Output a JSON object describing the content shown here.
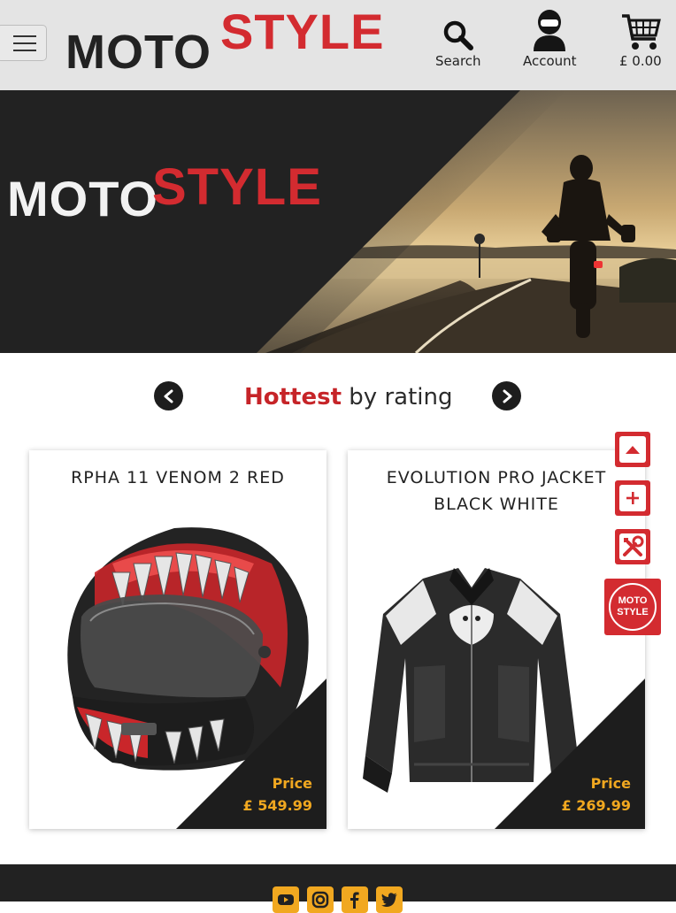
{
  "header": {
    "logo_moto": "MOTO",
    "logo_style": "STYLE",
    "search_label": "Search",
    "account_label": "Account",
    "cart_label": "£ 0.00"
  },
  "hero": {
    "logo_moto": "MOTO",
    "logo_style": "STYLE"
  },
  "section": {
    "title_highlight": "Hottest",
    "title_rest": "by rating"
  },
  "products": [
    {
      "name": "RPHA 11 VENOM 2 RED",
      "price_label": "Price",
      "price": "£ 549.99"
    },
    {
      "name": "EVOLUTION PRO JACKET BLACK WHITE",
      "price_label": "Price",
      "price": "£ 269.99"
    }
  ],
  "side_badge": {
    "line1": "MOTO",
    "line2": "STYLE"
  },
  "colors": {
    "brand_red": "#d32b30",
    "accent_gold": "#f1a820",
    "dark": "#1d1d1d",
    "header_bg": "#e4e4e4"
  },
  "icons": [
    "menu-icon",
    "search-icon",
    "account-icon",
    "cart-icon",
    "chevron-left-icon",
    "chevron-right-icon",
    "scroll-up-icon",
    "plus-icon",
    "tools-icon",
    "youtube-icon",
    "instagram-icon",
    "facebook-icon",
    "twitter-icon"
  ]
}
